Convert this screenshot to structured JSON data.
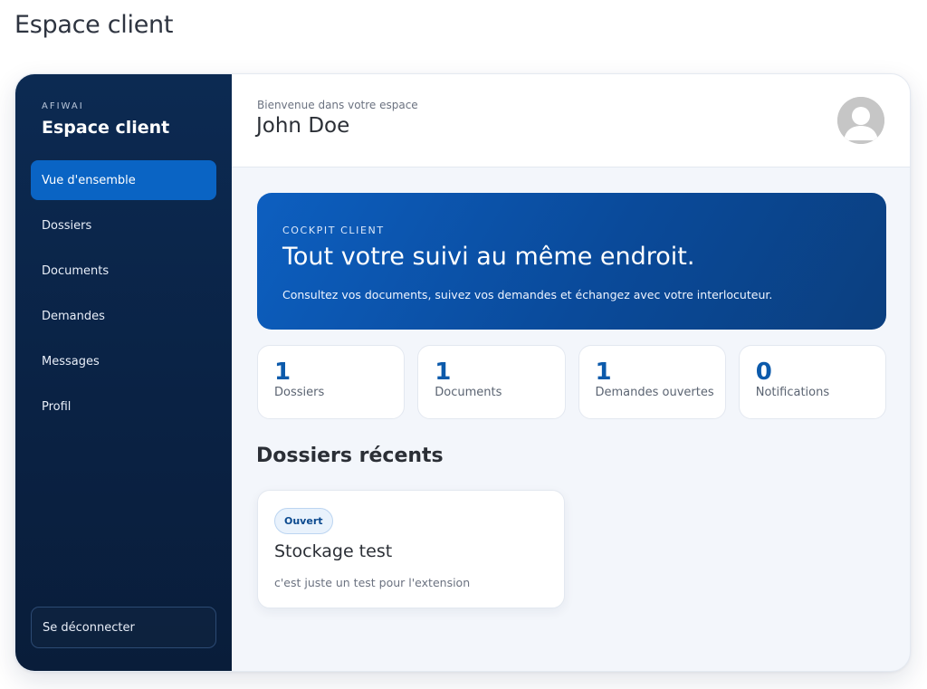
{
  "page": {
    "heading": "Espace client"
  },
  "sidebar": {
    "brand_kicker": "AFIWAI",
    "brand_title": "Espace client",
    "items": [
      {
        "label": "Vue d'ensemble",
        "active": true
      },
      {
        "label": "Dossiers"
      },
      {
        "label": "Documents"
      },
      {
        "label": "Demandes"
      },
      {
        "label": "Messages"
      },
      {
        "label": "Profil"
      }
    ],
    "logout_label": "Se déconnecter"
  },
  "header": {
    "welcome": "Bienvenue dans votre espace",
    "user_name": "John Doe",
    "avatar_icon": "user-avatar-icon"
  },
  "hero": {
    "kicker": "COCKPIT CLIENT",
    "title": "Tout votre suivi au même endroit.",
    "text": "Consultez vos documents, suivez vos demandes et échangez avec votre interlocuteur."
  },
  "stats": [
    {
      "value": "1",
      "label": "Dossiers"
    },
    {
      "value": "1",
      "label": "Documents"
    },
    {
      "value": "1",
      "label": "Demandes ouvertes"
    },
    {
      "value": "0",
      "label": "Notifications"
    }
  ],
  "recent": {
    "title": "Dossiers récents",
    "cases": [
      {
        "status": "Ouvert",
        "title": "Stockage test",
        "description": "c'est juste un test pour l'extension"
      }
    ]
  },
  "colors": {
    "sidebar_bg": "#0a2244",
    "accent": "#0a64c4",
    "stat_value": "#0c5aab"
  }
}
